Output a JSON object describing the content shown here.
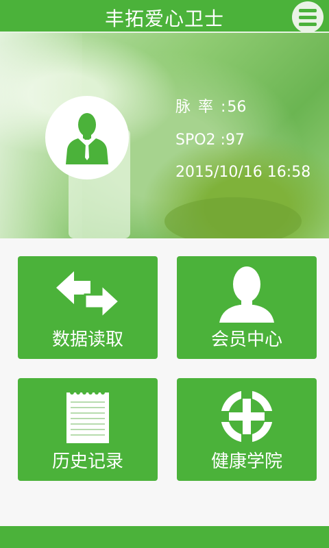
{
  "header": {
    "title": "丰拓爱心卫士",
    "menu_icon": "hamburger-menu-icon"
  },
  "profile": {
    "avatar_icon": "user-avatar-icon",
    "pulse_label": "脉  率 :",
    "pulse_value": "56",
    "spo2_label": "SPO2 :",
    "spo2_value": "97",
    "datetime": "2015/10/16 16:58"
  },
  "tiles": [
    {
      "label": "数据读取",
      "icon": "data-transfer-icon"
    },
    {
      "label": "会员中心",
      "icon": "member-icon"
    },
    {
      "label": "历史记录",
      "icon": "notepad-icon"
    },
    {
      "label": "健康学院",
      "icon": "medical-cross-icon"
    }
  ],
  "colors": {
    "primary": "#4bb23a",
    "background": "#f7f7f7",
    "text": "#ffffff"
  }
}
